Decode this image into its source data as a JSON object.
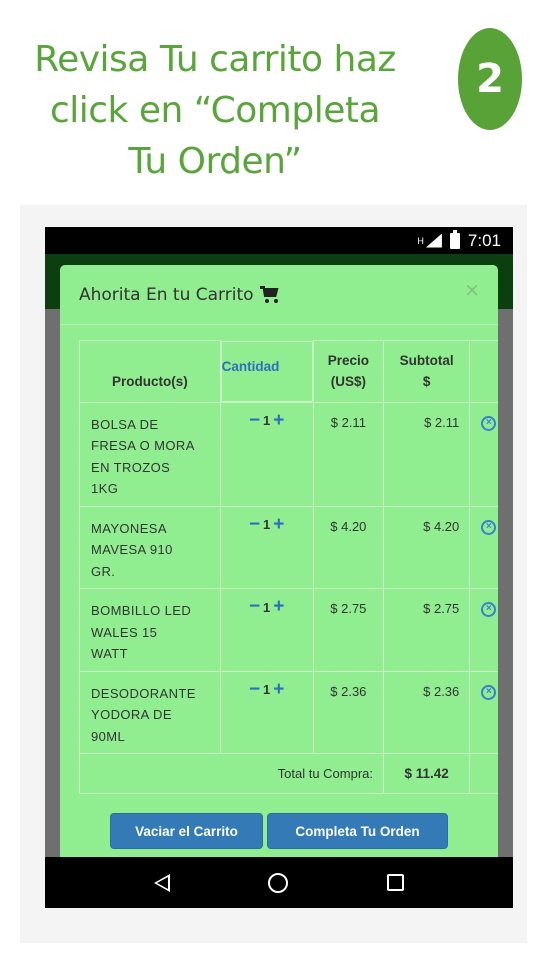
{
  "headline": {
    "line1": "Revisa Tu carrito haz",
    "line2": "click en “Completa",
    "line3": "Tu Orden”",
    "step": "2",
    "color": "#5aa53b"
  },
  "status_bar": {
    "network": "H",
    "time": "7:01"
  },
  "modal": {
    "title": "Ahorita En tu Carrito",
    "close": "×",
    "background": "#90ee90"
  },
  "table": {
    "headers": {
      "product": "Producto(s)",
      "quantity": "Cantidad",
      "price_line1": "Precio",
      "price_line2": "(US$)",
      "subtotal_line1": "Subtotal",
      "subtotal_line2": "$"
    },
    "rows": [
      {
        "name_lines": [
          "BOLSA DE",
          "FRESA O MORA",
          "EN TROZOS",
          "1KG"
        ],
        "minus": "−",
        "qty": "1",
        "plus": "+",
        "price": "$ 2.11",
        "subtotal": "$ 2.11"
      },
      {
        "name_lines": [
          "MAYONESA",
          "MAVESA 910",
          "GR."
        ],
        "minus": "−",
        "qty": "1",
        "plus": "+",
        "price": "$ 4.20",
        "subtotal": "$ 4.20"
      },
      {
        "name_lines": [
          "BOMBILLO LED",
          "WALES 15",
          "WATT"
        ],
        "minus": "−",
        "qty": "1",
        "plus": "+",
        "price": "$ 2.75",
        "subtotal": "$ 2.75"
      },
      {
        "name_lines": [
          "DESODORANTE",
          "YODORA DE",
          "90ML"
        ],
        "minus": "−",
        "qty": "1",
        "plus": "+",
        "price": "$ 2.36",
        "subtotal": "$ 2.36"
      }
    ],
    "total_label": "Total tu Compra:",
    "total_value": "$ 11.42"
  },
  "buttons": {
    "empty_cart": "Vaciar el Carrito",
    "complete_order": "Completa Tu Orden",
    "color": "#337ab7"
  },
  "icons": {
    "cart": "shopping-cart-icon",
    "close": "close-icon",
    "remove": "remove-circle-icon",
    "nav_back": "back-icon",
    "nav_home": "home-icon",
    "nav_recent": "recent-apps-icon"
  }
}
